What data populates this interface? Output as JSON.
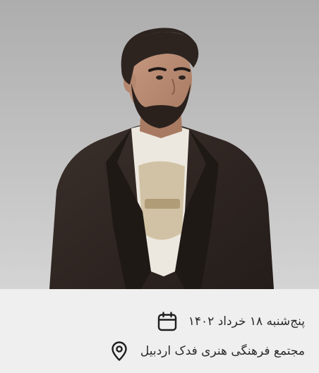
{
  "event_card": {
    "photo": {
      "icon": "performer-portrait"
    },
    "date": {
      "text": "پنج‌شنبه ۱۸ خرداد ۱۴۰۲",
      "icon": "calendar-icon"
    },
    "venue": {
      "text": "مجتمع فرهنگی هنری فدک اردبیل",
      "icon": "location-pin-icon"
    }
  },
  "colors": {
    "background": "#efefef",
    "text": "#2b2b2b",
    "icon": "#1e1e1e",
    "photo_backdrop": "#c4c4c4"
  }
}
